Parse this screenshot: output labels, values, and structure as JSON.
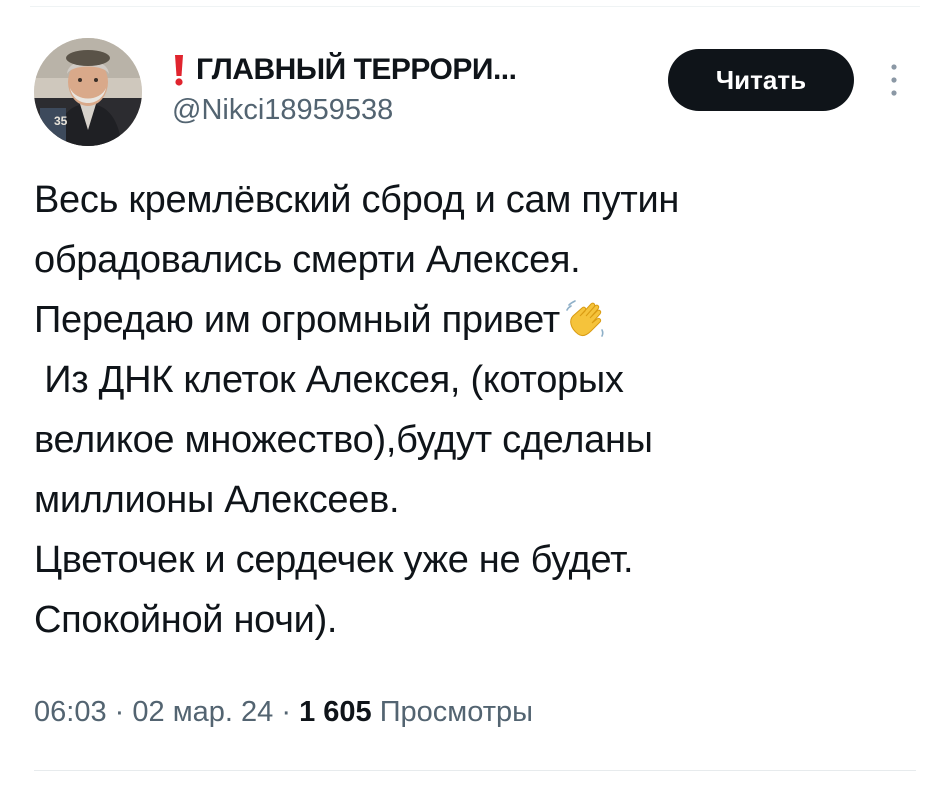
{
  "author": {
    "display_name": "ГЛАВНЫЙ ТЕРРОРИ...",
    "handle": "@Nikci18959538",
    "name_prefix_icon": "exclamation-icon",
    "avatar_badge": "35"
  },
  "follow_button": {
    "label": "Читать"
  },
  "more_menu": {
    "icon": "vertical-ellipsis-icon"
  },
  "tweet": {
    "lines": [
      "Весь кремлёвский сброд и сам путин",
      "обрадовались смерти Алексея.",
      "Передаю им огромный привет",
      " Из ДНК клеток Алексея, (которых",
      "великое множество),будут сделаны",
      "миллионы Алексеев.",
      "Цветочек и сердечек уже не будет.",
      "Спокойной ночи)."
    ],
    "emoji": "waving-hand-icon"
  },
  "meta": {
    "time": "06:03",
    "separator": "·",
    "date": "02 мар. 24",
    "views_count": "1 605",
    "views_label": "Просмотры"
  },
  "colors": {
    "text_primary": "#0f1419",
    "text_secondary": "#536471",
    "button_bg": "#0f1419",
    "button_text": "#ffffff",
    "exclamation_red": "#e0242e",
    "emoji_yellow": "#f5c33b"
  }
}
